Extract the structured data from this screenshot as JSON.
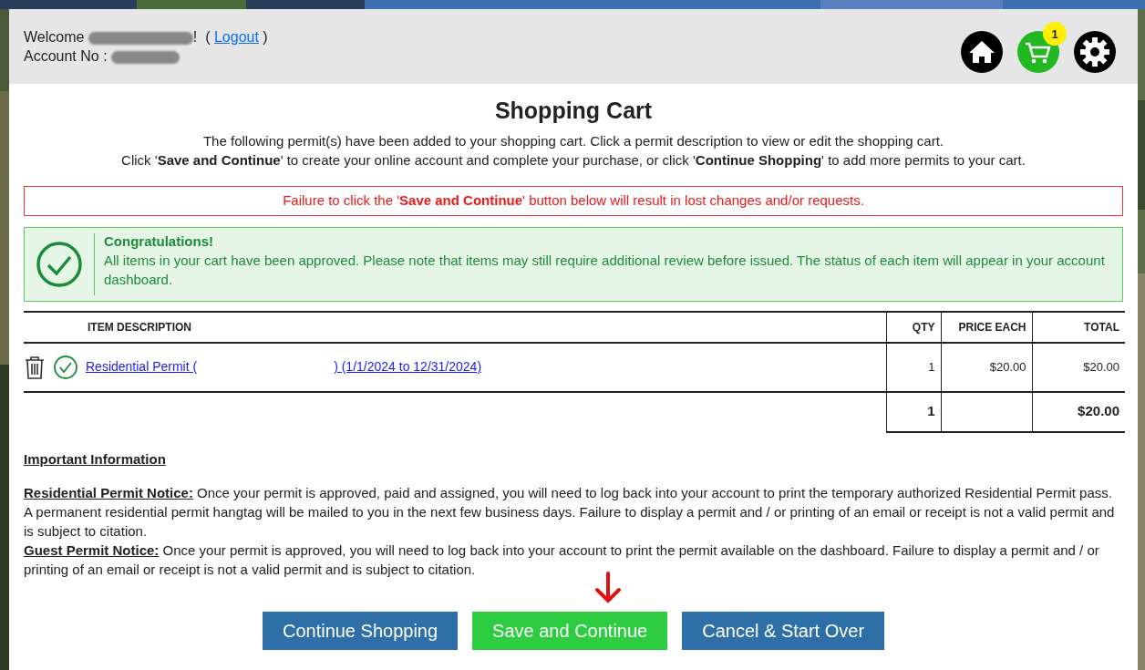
{
  "header": {
    "welcome": "Welcome",
    "welcome_end": "!",
    "logout_open": "(",
    "logout": "Logout",
    "logout_close": ")",
    "account_label": "Account No :",
    "cart_count": "1"
  },
  "title": "Shopping Cart",
  "intro": [
    "The following permit(s) have been added to your shopping cart. Click a permit description to view or edit the shopping cart.",
    "Click '**Save and Continue**' to create your online account and complete your purchase, or click '**Continue Shopping**' to add more permits to your cart."
  ],
  "warning": "Failure to click the '**Save and Continue**' button below will result in lost changes and/or requests.",
  "alert": {
    "title": "Congratulations!",
    "text": "All items in your cart have been approved. Please note that items may still require additional review before issued. The status of each item will appear in your account dashboard."
  },
  "table": {
    "columns": [
      "ITEM DESCRIPTION",
      "QTY",
      "PRICE EACH",
      "TOTAL"
    ],
    "rows": [
      {
        "description_start": "Residential Permit (",
        "description_end": ") (1/1/2024 to 12/31/2024)",
        "approved": true,
        "qty": "1",
        "price": "$20.00",
        "total": "$20.00"
      }
    ],
    "footer": {
      "qty": "1",
      "total": "$20.00"
    }
  },
  "info": {
    "heading": "Important Information",
    "notices": [
      {
        "label": "Residential Permit Notice:",
        "text": "Once your permit is approved, paid and assigned, you will need to log back into your account to print the temporary authorized Residential Permit pass. A permanent residential permit hangtag will be mailed to you in the next few business days. Failure to display a permit and / or printing of an email or receipt is not a valid permit and is subject to citation."
      },
      {
        "label": "Guest Permit Notice:",
        "text": "Once your permit is approved, you will need to log back into your account to print the permit available on the dashboard. Failure to display a permit and / or printing of an email or receipt is not a valid permit and is subject to citation."
      }
    ]
  },
  "buttons": [
    {
      "label": "Continue Shopping",
      "kind": "secondary"
    },
    {
      "label": "Save and Continue",
      "kind": "primary"
    },
    {
      "label": "Cancel & Start Over",
      "kind": "secondary"
    }
  ]
}
